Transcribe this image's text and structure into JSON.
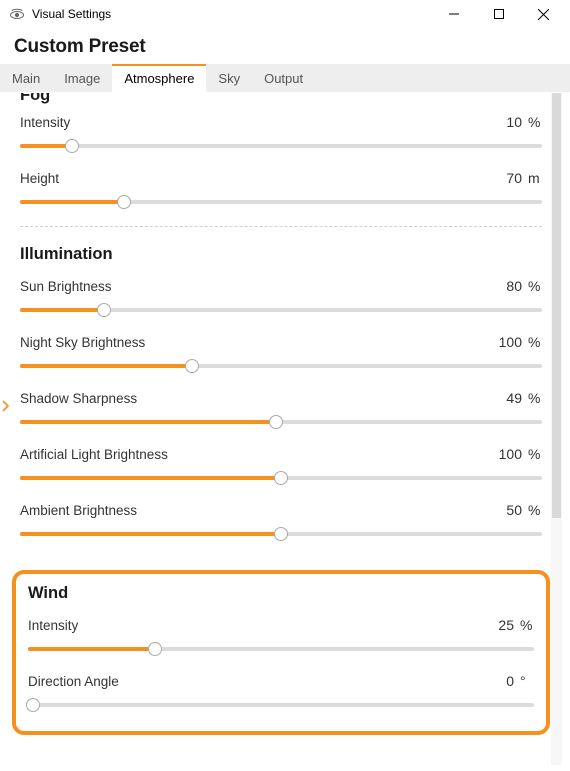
{
  "window": {
    "title": "Visual Settings"
  },
  "heading": "Custom Preset",
  "tabs": [
    {
      "label": "Main",
      "active": false
    },
    {
      "label": "Image",
      "active": false
    },
    {
      "label": "Atmosphere",
      "active": true
    },
    {
      "label": "Sky",
      "active": false
    },
    {
      "label": "Output",
      "active": false
    }
  ],
  "colors": {
    "accent": "#f6901e"
  },
  "sections": {
    "fog": {
      "title": "Fog",
      "sliders": [
        {
          "label": "Intensity",
          "value": "10",
          "unit": "%",
          "pct": 10
        },
        {
          "label": "Height",
          "value": "70",
          "unit": "m",
          "pct": 20
        }
      ]
    },
    "illumination": {
      "title": "Illumination",
      "sliders": [
        {
          "label": "Sun Brightness",
          "value": "80",
          "unit": "%",
          "pct": 16
        },
        {
          "label": "Night Sky Brightness",
          "value": "100",
          "unit": "%",
          "pct": 33
        },
        {
          "label": "Shadow Sharpness",
          "value": "49",
          "unit": "%",
          "pct": 49
        },
        {
          "label": "Artificial Light Brightness",
          "value": "100",
          "unit": "%",
          "pct": 50
        },
        {
          "label": "Ambient Brightness",
          "value": "50",
          "unit": "%",
          "pct": 50
        }
      ]
    },
    "wind": {
      "title": "Wind",
      "sliders": [
        {
          "label": "Intensity",
          "value": "25",
          "unit": "%",
          "pct": 25
        },
        {
          "label": "Direction Angle",
          "value": "0",
          "unit": "°",
          "pct": 0
        }
      ]
    }
  }
}
